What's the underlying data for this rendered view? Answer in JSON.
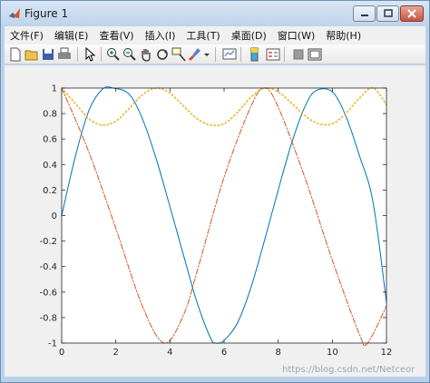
{
  "window": {
    "title": "Figure 1"
  },
  "menu": [
    "文件(F)",
    "编辑(E)",
    "查看(V)",
    "插入(I)",
    "工具(T)",
    "桌面(D)",
    "窗口(W)",
    "帮助(H)"
  ],
  "toolbar_icons": [
    "new-figure-icon",
    "open-file-icon",
    "save-icon",
    "print-icon",
    "edit-pointer-icon",
    "zoom-in-icon",
    "zoom-out-icon",
    "pan-icon",
    "rotate-3d-icon",
    "data-cursor-icon",
    "brush-icon",
    "brush-dropdown-icon",
    "link-plot-icon",
    "insert-colorbar-icon",
    "insert-legend-icon",
    "hide-plot-tools-icon",
    "show-plot-tools-icon"
  ],
  "watermark": "https://blog.csdn.net/Netceor",
  "colors": {
    "blue": "#0072bd",
    "orange": "#d95319",
    "yellow": "#edb120"
  },
  "chart_data": {
    "type": "line",
    "title": "",
    "xlabel": "",
    "ylabel": "",
    "xlim": [
      0,
      12
    ],
    "ylim": [
      -1,
      1
    ],
    "x_ticks": [
      "0",
      "2",
      "4",
      "6",
      "8",
      "10",
      "12"
    ],
    "y_ticks": [
      "-1",
      "-0.8",
      "-0.6",
      "-0.4",
      "-0.2",
      "0",
      "0.2",
      "0.4",
      "0.6",
      "0.8",
      "1"
    ],
    "grid": false,
    "series": [
      {
        "style": "solid",
        "color": "#0072bd",
        "x": [
          0,
          0.5,
          1,
          1.5,
          1.9,
          2.5,
          3,
          3.5,
          4,
          4.5,
          5,
          5.5,
          5.7,
          6,
          6.5,
          7,
          7.5,
          8,
          8.5,
          9,
          9.4,
          10,
          10.5,
          11,
          11.5,
          12
        ],
        "y": [
          0,
          0.46,
          0.82,
          0.99,
          1.0,
          0.95,
          0.75,
          0.44,
          0.07,
          -0.31,
          -0.68,
          -0.96,
          -1.0,
          -0.98,
          -0.84,
          -0.56,
          -0.19,
          0.2,
          0.57,
          0.86,
          0.98,
          0.97,
          0.78,
          0.47,
          0.11,
          -0.68
        ]
      },
      {
        "style": "dashdot",
        "color": "#d95319",
        "x": [
          0,
          1,
          2,
          3,
          3.8,
          4.5,
          5,
          6,
          7,
          7.5,
          8,
          9,
          10,
          11,
          11.3,
          12
        ],
        "y": [
          1,
          0.5,
          -0.1,
          -0.72,
          -1.0,
          -0.78,
          -0.44,
          0.3,
          0.86,
          1.0,
          0.85,
          0.29,
          -0.35,
          -0.93,
          -1.0,
          -0.71
        ]
      },
      {
        "style": "dotted",
        "color": "#edb120",
        "x": [
          0,
          0.5,
          1,
          1.5,
          2,
          2.5,
          3,
          3.5,
          4,
          4.5,
          5,
          5.5,
          6,
          6.5,
          7,
          7.5,
          8,
          8.5,
          9,
          9.5,
          10,
          10.5,
          11,
          11.5,
          12
        ],
        "y": [
          1,
          0.88,
          0.76,
          0.71,
          0.74,
          0.84,
          0.95,
          1.0,
          0.96,
          0.86,
          0.76,
          0.71,
          0.72,
          0.81,
          0.93,
          1.0,
          0.97,
          0.88,
          0.78,
          0.72,
          0.72,
          0.8,
          0.92,
          1.0,
          0.87
        ]
      }
    ]
  }
}
